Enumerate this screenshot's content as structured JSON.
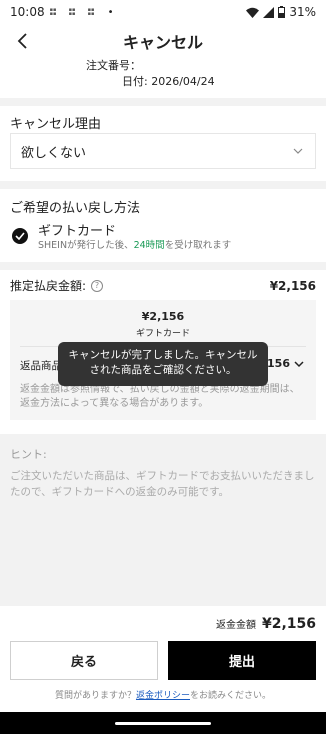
{
  "status_bar": {
    "time": "10:08",
    "battery": "31%"
  },
  "header": {
    "title": "キャンセル"
  },
  "order": {
    "number_label": "注文番号：",
    "date_label": "日付: 2026/04/24"
  },
  "reason": {
    "title": "キャンセル理由",
    "selected": "欲しくない"
  },
  "refund": {
    "title": "ご希望の払い戻し方法",
    "option_label": "ギフトカード",
    "desc_prefix": "SHEINが発行した後、",
    "desc_highlight": "24時間",
    "desc_suffix": "を受け取れます"
  },
  "estimate": {
    "label": "推定払戻金額:",
    "value": "¥2,156",
    "box_amount": "¥2,156",
    "box_method": "ギフトカード",
    "row_label": "返品商品の合計",
    "row_value": "¥2,156",
    "note": "返金金額は参照情報で、払い戻しの金額と実際の返金期間は、返金方法によって異なる場合があります。"
  },
  "toast": {
    "text": "キャンセルが完了しました。キャンセルされた商品をご確認ください。"
  },
  "hint": {
    "title": "ヒント:",
    "text": "ご注文いただいた商品は、ギフトカードでお支払いいただきましたので、ギフトカードへの返金のみ可能です。"
  },
  "total": {
    "label": "返金金額",
    "value": "¥2,156"
  },
  "buttons": {
    "back": "戻る",
    "submit": "提出"
  },
  "footer": {
    "prefix": "質問がありますか？",
    "link": "返金ポリシー",
    "suffix": "をお読みください。"
  }
}
